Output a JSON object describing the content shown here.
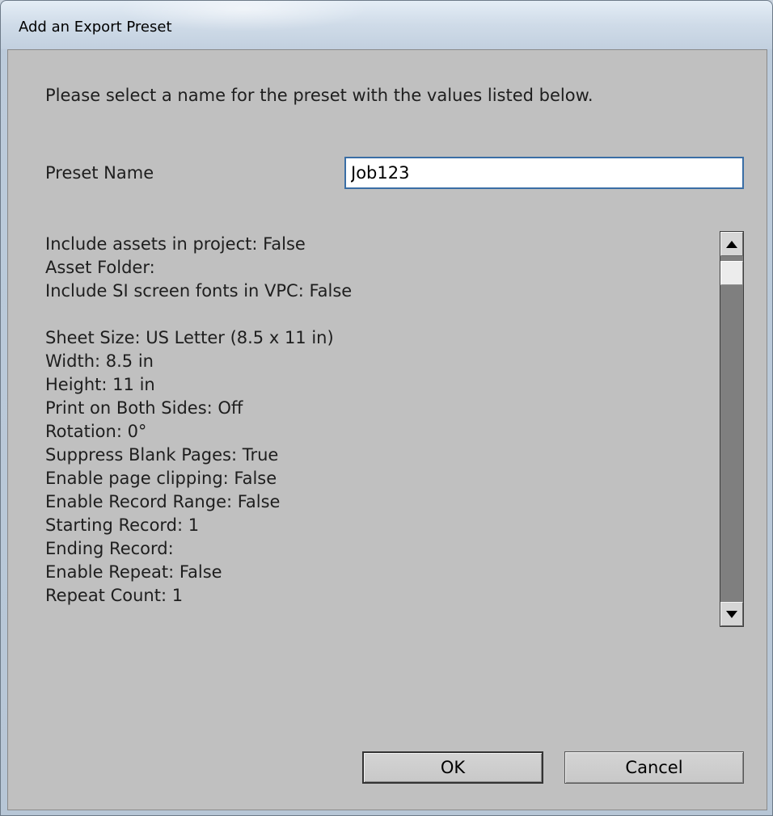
{
  "window": {
    "title": "Add an Export Preset"
  },
  "dialog": {
    "instruction": "Please select a name for the preset with the values listed below.",
    "preset_name_label": "Preset Name",
    "preset_name_value": "Job123"
  },
  "values_list": {
    "group1": [
      "Include assets in project: False",
      "Asset Folder:",
      "Include SI screen fonts in VPC: False"
    ],
    "group2": [
      "Sheet Size: US Letter (8.5 x 11 in)",
      "Width: 8.5 in",
      "Height: 11 in",
      "Print on Both Sides: Off",
      "Rotation: 0°",
      "Suppress Blank Pages: True",
      "Enable page clipping: False",
      "Enable Record Range: False",
      "Starting Record: 1",
      "Ending Record:",
      "Enable Repeat: False",
      "Repeat Count: 1"
    ]
  },
  "buttons": {
    "ok": "OK",
    "cancel": "Cancel"
  },
  "icons": {
    "scroll_up": "scroll-up-arrow-icon",
    "scroll_down": "scroll-down-arrow-icon"
  }
}
